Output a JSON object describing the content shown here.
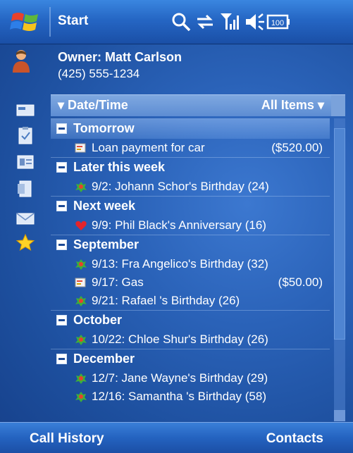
{
  "titlebar": {
    "start_label": "Start",
    "icons": [
      "windows-logo",
      "search-icon",
      "sync-icon",
      "signal-icon",
      "volume-icon",
      "battery-icon"
    ],
    "battery_text": "100"
  },
  "owner": {
    "name": "Owner: Matt Carlson",
    "phone": "(425) 555-1234"
  },
  "sidebar": {
    "tabs": [
      "card-icon",
      "clipboard-icon",
      "contacts-icon",
      "document-icon",
      "mail-icon",
      "star-icon"
    ]
  },
  "list_header": {
    "sort_label": "Date/Time",
    "filter_label": "All Items"
  },
  "groups": [
    {
      "label": "Tomorrow",
      "items": [
        {
          "text": "Loan payment for car",
          "amount": "($520.00)",
          "icon": "payment-icon"
        }
      ]
    },
    {
      "label": "Later this week",
      "items": [
        {
          "text": "9/2: Johann Schor's Birthday (24)",
          "amount": "",
          "icon": "birthday-icon"
        }
      ]
    },
    {
      "label": "Next week",
      "items": [
        {
          "text": "9/9: Phil Black's Anniversary (16)",
          "amount": "",
          "icon": "heart-icon"
        }
      ]
    },
    {
      "label": "September",
      "items": [
        {
          "text": "9/13: Fra Angelico's Birthday (32)",
          "amount": "",
          "icon": "birthday-icon"
        },
        {
          "text": "9/17: Gas",
          "amount": "($50.00)",
          "icon": "payment-icon"
        },
        {
          "text": "9/21: Rafael 's Birthday (26)",
          "amount": "",
          "icon": "birthday-icon"
        }
      ]
    },
    {
      "label": "October",
      "items": [
        {
          "text": "10/22: Chloe Shur's Birthday (26)",
          "amount": "",
          "icon": "birthday-icon"
        }
      ]
    },
    {
      "label": "December",
      "items": [
        {
          "text": "12/7: Jane Wayne's Birthday (29)",
          "amount": "",
          "icon": "birthday-icon"
        },
        {
          "text": "12/16: Samantha 's Birthday (58)",
          "amount": "",
          "icon": "birthday-icon"
        }
      ]
    }
  ],
  "softkeys": {
    "left": "Call History",
    "right": "Contacts"
  },
  "colors": {
    "background": "#2a62b8",
    "header_bar": "#5d8dd3",
    "text": "#ffffff"
  }
}
